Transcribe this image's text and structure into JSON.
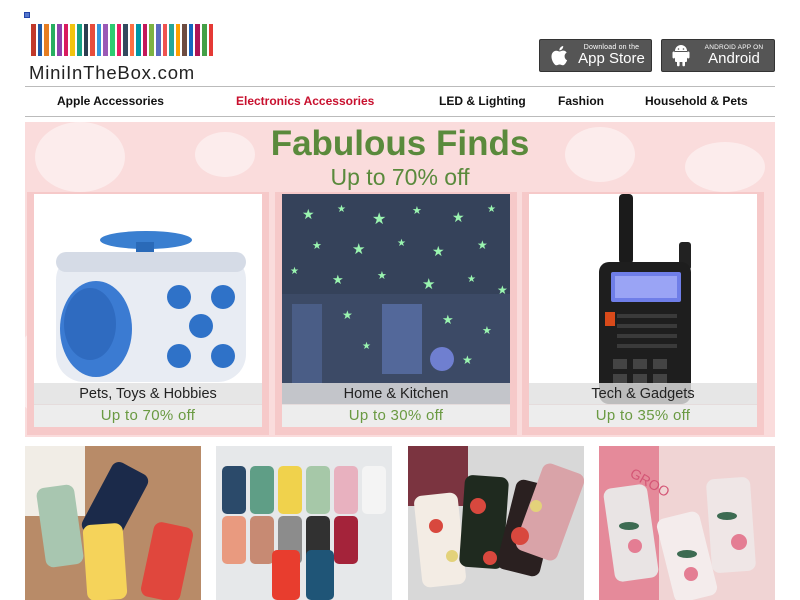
{
  "logo": {
    "text": "MiniInTheBox.com"
  },
  "stores": {
    "apple": {
      "small": "Download on the",
      "big": "App Store"
    },
    "android": {
      "small": "ANDROID APP ON",
      "big": "Android"
    }
  },
  "nav": {
    "items": [
      {
        "label": "Apple Accessories"
      },
      {
        "label": "Electronics Accessories"
      },
      {
        "label": "LED & Lighting"
      },
      {
        "label": "Fashion"
      },
      {
        "label": "Household & Pets"
      }
    ]
  },
  "banner": {
    "title": "Fabulous Finds",
    "subtitle": "Up to 70% off",
    "cards": [
      {
        "category": "Pets, Toys & Hobbies",
        "discount": "Up to 70% off"
      },
      {
        "category": "Home & Kitchen",
        "discount": "Up to 30% off"
      },
      {
        "category": "Tech & Gadgets",
        "discount": "Up to 35% off"
      }
    ]
  },
  "colors": {
    "accent_red": "#c8102e",
    "promo_green": "#5a8a3c",
    "banner_pink": "#fadcdc"
  }
}
